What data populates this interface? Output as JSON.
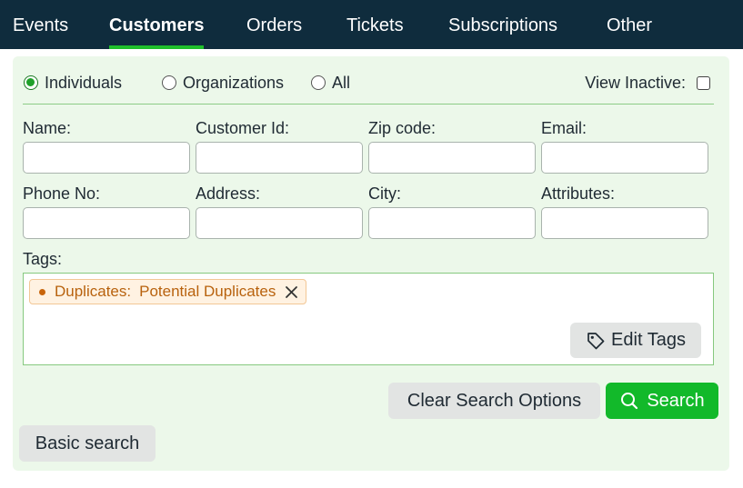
{
  "nav": {
    "tabs": [
      {
        "label": "Events"
      },
      {
        "label": "Customers",
        "active": true
      },
      {
        "label": "Orders"
      },
      {
        "label": "Tickets"
      },
      {
        "label": "Subscriptions"
      },
      {
        "label": "Other"
      }
    ]
  },
  "filter": {
    "radios": [
      {
        "label": "Individuals",
        "checked": true
      },
      {
        "label": "Organizations",
        "checked": false
      },
      {
        "label": "All",
        "checked": false
      }
    ],
    "view_inactive_label": "View Inactive:",
    "view_inactive_checked": false
  },
  "fields": {
    "name": {
      "label": "Name:",
      "value": ""
    },
    "customer_id": {
      "label": "Customer Id:",
      "value": ""
    },
    "zip": {
      "label": "Zip code:",
      "value": ""
    },
    "email": {
      "label": "Email:",
      "value": ""
    },
    "phone": {
      "label": "Phone No:",
      "value": ""
    },
    "address": {
      "label": "Address:",
      "value": ""
    },
    "city": {
      "label": "City:",
      "value": ""
    },
    "attributes": {
      "label": "Attributes:",
      "value": ""
    }
  },
  "tags": {
    "label": "Tags:",
    "chip": {
      "category": "Duplicates:",
      "value": "Potential Duplicates"
    },
    "edit_label": "Edit Tags"
  },
  "actions": {
    "clear_label": "Clear Search Options",
    "search_label": "Search",
    "basic_label": "Basic search"
  },
  "colors": {
    "nav_bg": "#0f2c3d",
    "accent_green": "#12b92a",
    "panel_bg": "#ecf8ea",
    "tag_text": "#b8620e"
  },
  "icons": {
    "tag_remove": "close-icon",
    "edit_tags": "tag-icon",
    "search": "search-icon"
  }
}
